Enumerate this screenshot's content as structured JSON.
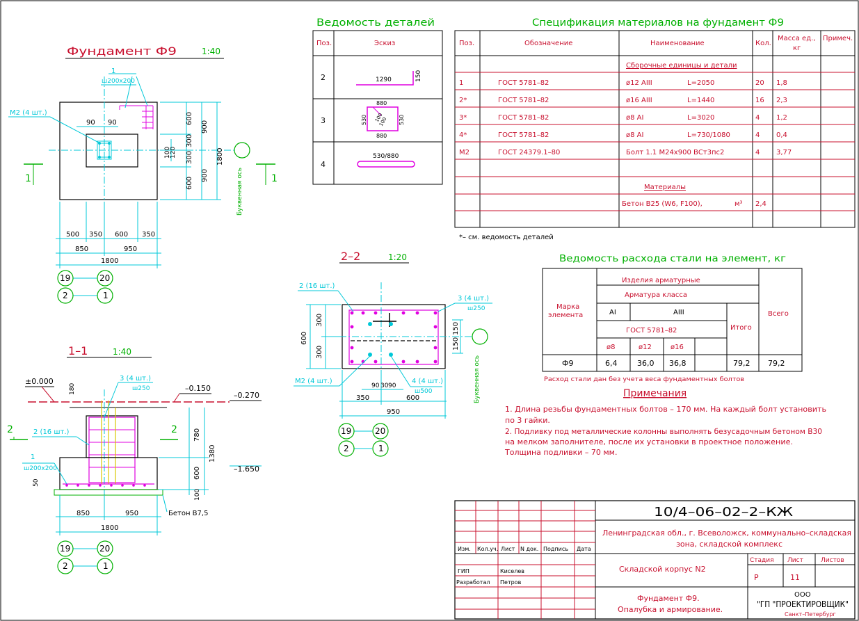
{
  "colors": {
    "black": "#000000",
    "red": "#c8102e",
    "cyan": "#00c8d8",
    "green": "#00b000",
    "magenta": "#e000e0",
    "yellow": "#d8c800",
    "blue": "#3040ff"
  },
  "plan": {
    "title": "Фундамент Ф9",
    "scale": "1:40",
    "m2": "М2 (4 шт.)",
    "label1": "1",
    "labelsize": "ш200х200",
    "dims": {
      "d500": "500",
      "d350a": "350",
      "d600": "600",
      "d350b": "350",
      "d850": "850",
      "d950": "950",
      "d1800": "1800",
      "d90a": "90",
      "d90b": "90",
      "v600a": "600",
      "v300a": "300",
      "v300b": "300",
      "v600b": "600",
      "v900a": "900",
      "v900b": "900",
      "v1800": "1800",
      "v100": "100",
      "v120": "120"
    },
    "axis": "Буквенная ось",
    "cut": "1",
    "grid": {
      "a": "19",
      "b": "20",
      "c": "2",
      "d": "1"
    }
  },
  "sec11": {
    "title": "1–1",
    "scale": "1:40",
    "lvl0": "±0.000",
    "lvl1": "–0.150",
    "lvl2": "–0.270",
    "lvl3": "–1.650",
    "m1": "3 (4 шт.)",
    "m1b": "ш250",
    "m2": "2 (16 шт.)",
    "m3": "1",
    "m3b": "ш200х200",
    "beton": "Бетон В7,5",
    "cut": "2",
    "dims": {
      "d850": "850",
      "d950": "950",
      "d1800": "1800",
      "v180": "180",
      "v780": "780",
      "v1380": "1380",
      "v600": "600",
      "v100": "100",
      "v50": "50"
    },
    "grid": {
      "a": "19",
      "b": "20",
      "c": "2",
      "d": "1"
    }
  },
  "sec22": {
    "title": "2–2",
    "scale": "1:20",
    "m1": "2 (16 шт.)",
    "m2": "3 (4 шт.)",
    "m2b": "ш250",
    "m3": "4 (4 шт.)",
    "m3b": "ш500",
    "m4": "М2 (4 шт.)",
    "axis": "Буквенная ось",
    "dims": {
      "d350": "350",
      "d600": "600",
      "d950": "950",
      "d90a": "90",
      "d30": "30",
      "d90b": "90",
      "v300a": "300",
      "v300b": "300",
      "v600": "600",
      "v150a": "150",
      "v150b": "150"
    },
    "grid": {
      "a": "19",
      "b": "20",
      "c": "2",
      "d": "1"
    }
  },
  "details": {
    "title": "Ведомость деталей",
    "h_pos": "Поз.",
    "h_sketch": "Эскиз",
    "rows": [
      {
        "pos": "2",
        "a": "1290",
        "b": "150"
      },
      {
        "pos": "3",
        "a": "880",
        "b": "530",
        "c": "100",
        "d": "100",
        "e": "530",
        "f": "880"
      },
      {
        "pos": "4",
        "a": "530/880"
      }
    ]
  },
  "spec": {
    "title": "Спецификация материалов на фундамент Ф9",
    "headers": [
      "Поз.",
      "Обозначение",
      "Наименование",
      "Кол.",
      "Масса ед., кг",
      "Примеч."
    ],
    "sub1": "Сборочные единицы и детали",
    "rows": [
      {
        "pos": "1",
        "doc": "ГОСТ 5781–82",
        "name": "ø12  AIII",
        "len": "L=2050",
        "qty": "20",
        "mass": "1,8"
      },
      {
        "pos": "2*",
        "doc": "ГОСТ 5781–82",
        "name": "ø16  AIII",
        "len": "L=1440",
        "qty": "16",
        "mass": "2,3"
      },
      {
        "pos": "3*",
        "doc": "ГОСТ 5781–82",
        "name": "ø8  AI",
        "len": "L=3020",
        "qty": "4",
        "mass": "1,2"
      },
      {
        "pos": "4*",
        "doc": "ГОСТ 5781–82",
        "name": "ø8  AI",
        "len": "L=730/1080",
        "qty": "4",
        "mass": "0,4"
      },
      {
        "pos": "М2",
        "doc": "ГОСТ 24379.1–80",
        "name": "Болт 1.1  М24х900  ВСт3пс2",
        "len": "",
        "qty": "4",
        "mass": "3,77"
      }
    ],
    "sub2": "Материалы",
    "mat": {
      "name": "Бетон  В25  (W6, F100),",
      "unit": "м³",
      "qty": "2,4"
    },
    "note": "*– см. ведомость деталей"
  },
  "steel": {
    "title": "Ведомость расхода стали на элемент, кг",
    "h_izd": "Изделия арматурные",
    "h_arm": "Арматура класса",
    "h_mark": "Марка элемента",
    "h_ai": "AI",
    "h_aiii": "AIII",
    "h_gost": "ГОСТ 5781–82",
    "h_itogo": "Итого",
    "h_vsego": "Всего",
    "h_d8": "ø8",
    "h_d12": "ø12",
    "h_d16": "ø16",
    "row": {
      "mark": "Ф9",
      "d8": "6,4",
      "d12": "36,0",
      "d16": "36,8",
      "itogo": "79,2",
      "vsego": "79,2"
    },
    "note": "Расход стали дан без учета веса фундаментных болтов"
  },
  "notes": {
    "title": "Примечания",
    "lines": [
      "1.  Длина резьбы фундаментных болтов – 170 мм. На каждый болт установить",
      "     по 3 гайки.",
      "2.  Подливку под металлические колонны выполнять безусадочным бетоном В30",
      "     на мелком заполнителе, после их установки в проектное положение.",
      "     Толщина подливки – 70 мм."
    ]
  },
  "stamp": {
    "code": "10/4–06–02–2–КЖ",
    "address1": "Ленинградская обл., г. Всеволожск, коммунально–складская",
    "address2": "зона, складской комплекс",
    "object": "Складской корпус N2",
    "sheet": "Фундамент Ф9.",
    "sheet2": "Опалубка и армирование.",
    "stage_h": "Стадия",
    "list_h": "Лист",
    "lists_h": "Листов",
    "stage": "Р",
    "list": "11",
    "org1": "ООО",
    "org2": "\"ГП \"ПРОЕКТИРОВЩИК\"",
    "org3": "Санкт–Петербург",
    "cols": [
      "Изм.",
      "Кол.уч.",
      "Лист",
      "N док.",
      "Подпись",
      "Дата"
    ],
    "r1a": "ГИП",
    "r1b": "Киселев",
    "r2a": "Разработал",
    "r2b": "Петров"
  }
}
